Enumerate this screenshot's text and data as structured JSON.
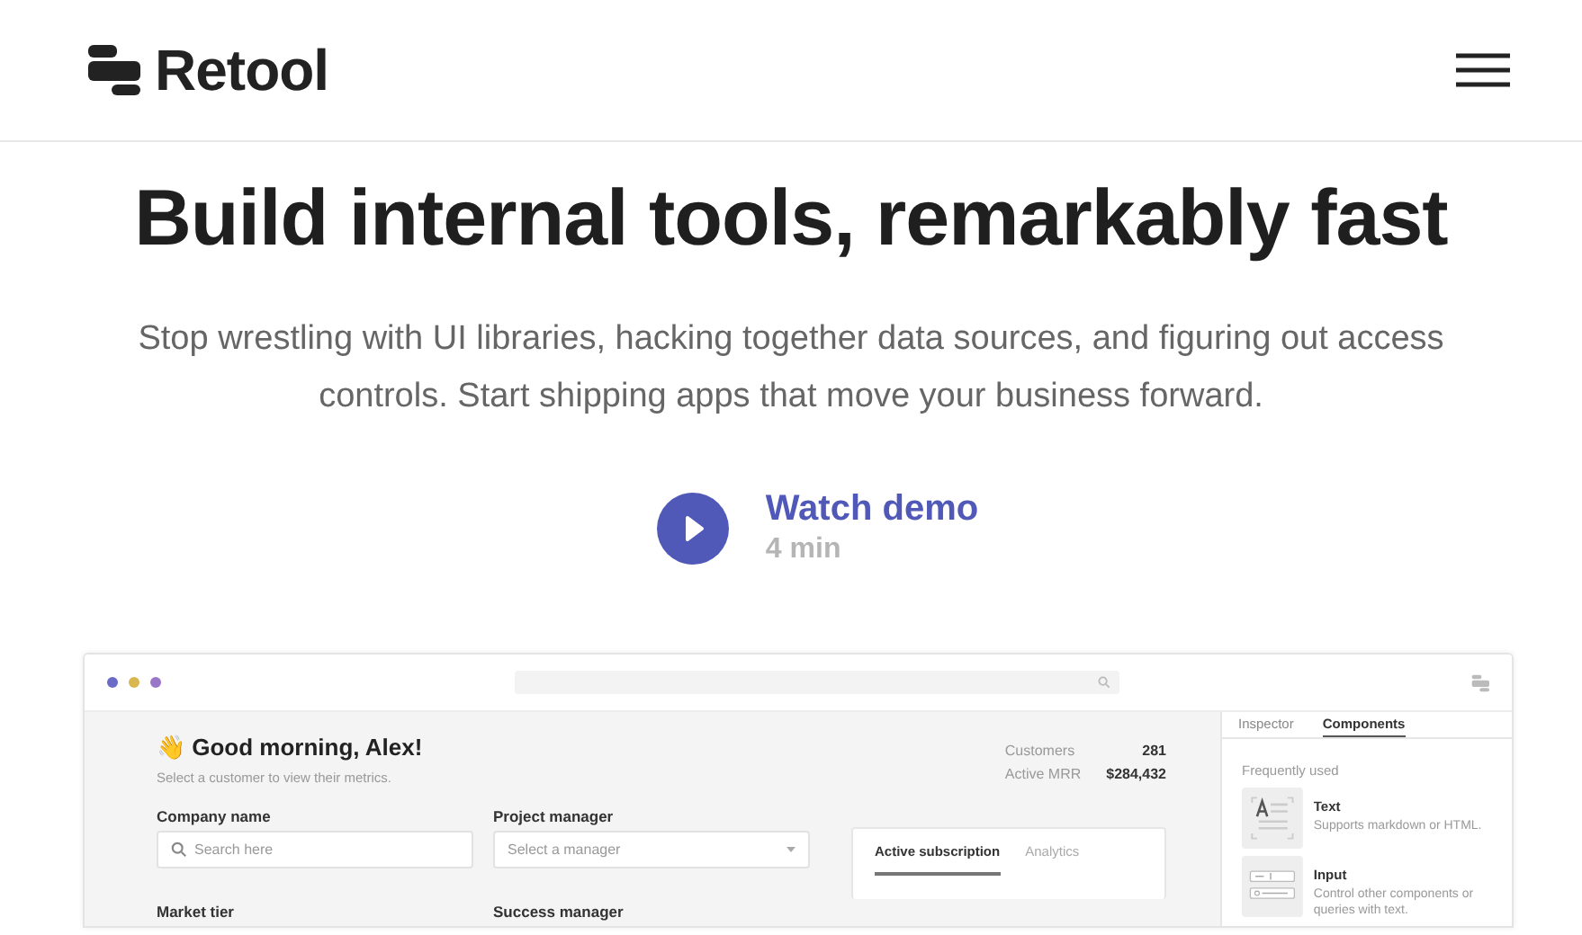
{
  "header": {
    "brand": "Retool"
  },
  "hero": {
    "title": "Build internal tools, remarkably fast",
    "subtitle": "Stop wrestling with UI libraries, hacking together data sources, and figuring out access controls. Start shipping apps that move your business forward.",
    "cta": "Watch demo",
    "duration": "4 min"
  },
  "app": {
    "greeting": "👋 Good morning, Alex!",
    "hint": "Select a customer to view their metrics.",
    "fields": [
      {
        "label": "Company name",
        "placeholder": "Search here",
        "kind": "search"
      },
      {
        "label": "Project manager",
        "placeholder": "Select a manager",
        "kind": "select"
      }
    ],
    "next_labels": [
      "Market tier",
      "Success manager"
    ],
    "metrics": [
      {
        "label": "Customers",
        "value": "281"
      },
      {
        "label": "Active MRR",
        "value": "$284,432"
      }
    ],
    "card_tabs": [
      {
        "label": "Active subscription",
        "selected": true
      },
      {
        "label": "Analytics",
        "selected": false
      }
    ],
    "panel_tabs": [
      {
        "label": "Inspector",
        "selected": false
      },
      {
        "label": "Components",
        "selected": true
      }
    ],
    "section": "Frequently used",
    "components": [
      {
        "kind": "text",
        "name": "Text",
        "description": "Supports markdown or HTML."
      },
      {
        "kind": "input",
        "name": "Input",
        "description": "Control other components or queries with text."
      }
    ]
  }
}
